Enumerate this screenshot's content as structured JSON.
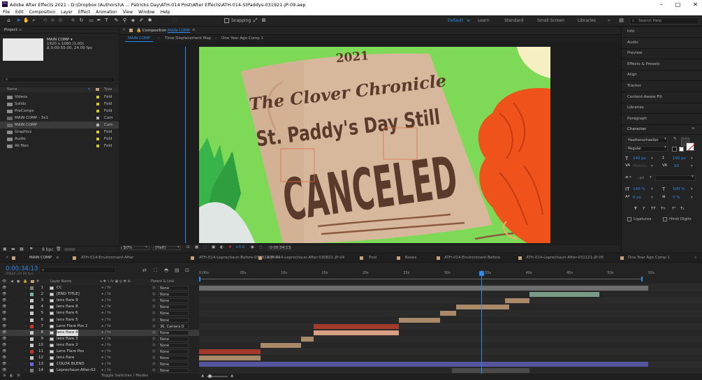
{
  "window": {
    "title": "Adobe After Effects 2021 - D:\\Dropbox (Authors)\\A ... Patricks Day\\ATH-014 Post\\After Effects\\ATH-014-StPaddys-031921-JP-09.aep",
    "app_icon": "Ae",
    "min": "–",
    "max": "□",
    "close": "✕"
  },
  "menu": [
    "File",
    "Edit",
    "Composition",
    "Layer",
    "Effect",
    "Animation",
    "View",
    "Window",
    "Help"
  ],
  "toolbar": {
    "snapping": "Snapping",
    "workspaces": [
      "Default",
      "Learn",
      "Standard",
      "Small Screen",
      "Libraries"
    ],
    "active_workspace": "Default",
    "overflow": "»",
    "search_placeholder": "Search Help"
  },
  "project": {
    "title": "Project",
    "comp_name": "MAIN COMP ▾",
    "comp_res": "1920 x 1080 (1.00)",
    "comp_dur": "Δ 0:00:55:00, 24.00 fps",
    "columns": {
      "name": "Name",
      "type": "Type"
    },
    "items": [
      {
        "name": "Videos",
        "type": "Fold",
        "kind": "folder"
      },
      {
        "name": "Solids",
        "type": "Fold",
        "kind": "folder"
      },
      {
        "name": "PreComps",
        "type": "Fold",
        "kind": "folder"
      },
      {
        "name": "MAIN COMP - 3x1",
        "type": "Com",
        "kind": "comp"
      },
      {
        "name": "MAIN COMP",
        "type": "Com",
        "kind": "comp",
        "selected": true
      },
      {
        "name": "Graphics",
        "type": "Fold",
        "kind": "folder"
      },
      {
        "name": "Audio",
        "type": "Fold",
        "kind": "folder"
      },
      {
        "name": "All files",
        "type": "Fold",
        "kind": "folder"
      }
    ],
    "bpc": "8 bpc"
  },
  "composition": {
    "panel_title": "Composition",
    "panel_comp": "MAIN COMP",
    "subtabs": [
      "MAIN COMP",
      "Time Displacement Map",
      "One Year Ago Comp 1"
    ],
    "artwork": {
      "year": "2021",
      "masthead": "The Clover Chronicle",
      "headline1": "St. Paddy's Day Still",
      "headline2": "CANCELED"
    },
    "zoom": "50%",
    "resolution": "(Half)",
    "exposure": "+0.0",
    "timecode": "0:00:34:13"
  },
  "right_panels": [
    "Info",
    "Audio",
    "Preview",
    "Effects & Presets",
    "Align",
    "Tracker",
    "Content-Aware Fill",
    "Libraries",
    "Paragraph"
  ],
  "character": {
    "title": "Character",
    "font": "Haettenschweiler",
    "style": "Regular",
    "size": "140 px",
    "leading": "190 px",
    "kerning": "Metrics",
    "tracking": "50",
    "stroke_unit": "- px",
    "vscale": "140 %",
    "hscale": "100 %",
    "baseline": "0 px",
    "tsume": "0 %",
    "ligatures": "Ligatures",
    "hindi": "Hindi Digits",
    "styles": [
      "T",
      "T",
      "TT",
      "Tт",
      "T¹",
      "T₁"
    ]
  },
  "timeline": {
    "tabs": [
      "MAIN COMP",
      "ATH-014-Environment-After",
      "ATH-014-Leprechaun-Before-030821-JP-04",
      "ATH-014-Leprechaun-After-030821-JP-04",
      "Pool",
      "Boxes",
      "ATH-014-Environment-Before",
      "ATH-014-Leprechaun-After-031121-JP-05",
      "One Year Ago Comp 1"
    ],
    "timecode": "0:00:34:13",
    "fps": "00829 (24.00 fps)",
    "column_layer_name": "Layer Name",
    "column_parent": "Parent & Link",
    "ruler": [
      "0:00s",
      "05s",
      "10s",
      "15s",
      "20s",
      "25s",
      "30s",
      "35s",
      "40s",
      "45s",
      "50s",
      "55s"
    ],
    "duration_s": 55,
    "playhead_s": 34.54,
    "footer": "Toggle Switches / Modes",
    "layers": [
      {
        "n": "1",
        "name": "CC",
        "color": "#7f7f7f",
        "parent": "None",
        "start": 0,
        "end": 55,
        "bar": "#6e6e6e"
      },
      {
        "n": "2",
        "name": "[END TITLE]",
        "color": "#7fb0a9",
        "parent": "None",
        "start": 40.5,
        "end": 49,
        "bar": "#7a9a88"
      },
      {
        "n": "3",
        "name": "lens flare 9",
        "color": "#c9c9c9",
        "parent": "None",
        "start": 37.5,
        "end": 40.5,
        "bar": "#a88a6a"
      },
      {
        "n": "4",
        "name": "lens flare 8",
        "color": "#c9c9c9",
        "parent": "None",
        "start": 31.5,
        "end": 38,
        "bar": "#a88a6a"
      },
      {
        "n": "5",
        "name": "lens flare 6",
        "color": "#c9c9c9",
        "parent": "None",
        "start": 29.5,
        "end": 31.5,
        "bar": "#a88a6a"
      },
      {
        "n": "6",
        "name": "lens flare 5",
        "color": "#c9c9c9",
        "parent": "None",
        "start": 24.5,
        "end": 29.5,
        "bar": "#a88a6a"
      },
      {
        "n": "7",
        "name": "Lens Flare Pos 2",
        "color": "#c0392b",
        "parent": "36. Camera D",
        "start": 14,
        "end": 24.5,
        "bar": "#a33a2a"
      },
      {
        "n": "8",
        "name": "lens flare 4",
        "color": "#c9c9c9",
        "parent": "None",
        "start": 14,
        "end": 24.5,
        "bar": "#d9a083",
        "selected": true
      },
      {
        "n": "9",
        "name": "lens flare 3",
        "color": "#c9c9c9",
        "parent": "None",
        "start": 12.5,
        "end": 14,
        "bar": "#a88a6a"
      },
      {
        "n": "10",
        "name": "lens flare 2",
        "color": "#c9c9c9",
        "parent": "None",
        "start": 7.5,
        "end": 12.5,
        "bar": "#a88a6a"
      },
      {
        "n": "11",
        "name": "Lens Flare Pos",
        "color": "#c0392b",
        "parent": "None",
        "start": 0,
        "end": 7.5,
        "bar": "#a33a2a"
      },
      {
        "n": "12",
        "name": "lens flare",
        "color": "#c9c9c9",
        "parent": "None",
        "start": 0,
        "end": 7.5,
        "bar": "#a88a6a"
      },
      {
        "n": "13",
        "name": "COLOR BLEND",
        "color": "#6a6ad8",
        "parent": "None",
        "start": 0,
        "end": 55,
        "bar": "#5555a0"
      },
      {
        "n": "14",
        "name": "Leprechaun-After-02",
        "color": "#7f7f7f",
        "parent": "None",
        "start": 31,
        "end": 40.5,
        "bar": "#4a4a4a"
      }
    ]
  },
  "colors": {
    "accent": "#2d8ceb",
    "background_green": "#7ed957",
    "paper": "#d8b89c",
    "ink": "#5a3a2a",
    "hair": "#e84a1a"
  }
}
